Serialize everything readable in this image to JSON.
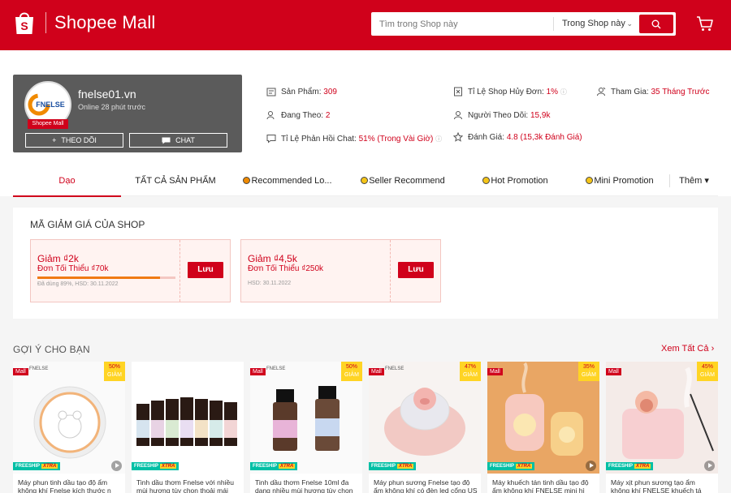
{
  "header": {
    "logo_text": "Shopee Mall",
    "search_placeholder": "Tìm trong Shop này",
    "search_scope": "Trong Shop này",
    "icons": [
      "shopee-bag-icon",
      "search-icon",
      "cart-icon",
      "chevron-down-icon"
    ]
  },
  "shop": {
    "name": "fnelse01.vn",
    "online": "Online 28 phút trước",
    "mall_badge": "Shopee Mall",
    "logo_text": "FNELSE",
    "follow_label": "THEO DÕI",
    "chat_label": "CHAT"
  },
  "stats": [
    {
      "label": "Sản Phẩm: ",
      "value": "309",
      "icon": "store-icon"
    },
    {
      "label": "Đang Theo: ",
      "value": "2",
      "icon": "user-add-icon"
    },
    {
      "label": "Tỉ Lệ Phản Hồi Chat: ",
      "value": "51% (Trong Vài Giờ)",
      "icon": "chat-icon"
    },
    {
      "label": "Tỉ Lệ Shop Hủy Đơn: ",
      "value": "1%",
      "icon": "cancel-icon"
    },
    {
      "label": "Người Theo Dõi: ",
      "value": "15,9k",
      "icon": "followers-icon"
    },
    {
      "label": "Đánh Giá: ",
      "value": "4.8 (15,3k Đánh Giá)",
      "icon": "star-icon"
    },
    {
      "label": "Tham Gia: ",
      "value": "35 Tháng Trước",
      "icon": "person-icon"
    }
  ],
  "tabs": [
    "Dạo",
    "TẤT CẢ SẢN PHẨM",
    "Recommended Lo...",
    "Seller Recommend",
    "Hot Promotion",
    "Mini Promotion",
    "Thêm ▾"
  ],
  "vouchers": {
    "title": "MÃ GIẢM GIÁ CỦA SHOP",
    "items": [
      {
        "amount": "Giảm ₫2k",
        "min": "Đơn Tối Thiểu ₫70k",
        "meta": "Đã dùng 89%, HSD: 30.11.2022",
        "used": 0.89,
        "button": "Lưu"
      },
      {
        "amount": "Giảm ₫4,5k",
        "min": "Đơn Tối Thiểu ₫250k",
        "meta": "HSD: 30.11.2022",
        "button": "Lưu"
      }
    ]
  },
  "recommend": {
    "title": "GỢI Ý CHO BẠN",
    "see_all": "Xem Tất Cả",
    "mall_tag": "Mall",
    "brand": "FNELSE",
    "freeship": "FREESHIP",
    "xtra": "XTRA",
    "off_word": "GIẢM",
    "products": [
      {
        "name": "Máy phun tinh dầu tạo độ ẩm không khí Fnelse kích thước n",
        "discount": "50%"
      },
      {
        "name": "Tinh dầu thơm Fnelse với nhiều mùi hương tùy chọn thoải mái",
        "discount": ""
      },
      {
        "name": "Tinh dầu thơm Fnelse 10ml đa dạng nhiều mùi hương tùy chọn",
        "discount": "50%"
      },
      {
        "name": "Máy phun sương Fnelse tạo độ ẩm không khí có đèn led cổng US",
        "discount": "47%"
      },
      {
        "name": "Máy khuếch tán tinh dầu tạo độ ẩm không khí FNELSE mini hì",
        "discount": "35%"
      },
      {
        "name": "Máy xịt phun sương tạo ẩm không khí FNELSE khuếch tá",
        "discount": "45%"
      }
    ]
  },
  "colors": {
    "brand": "#d0011b",
    "accent_yellow": "#ffd424",
    "freeship": "#00bfa5"
  }
}
